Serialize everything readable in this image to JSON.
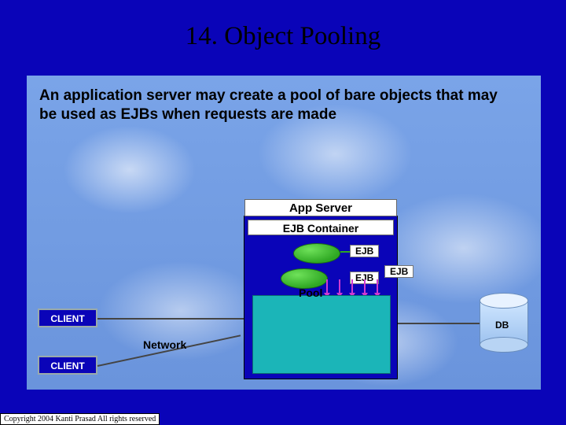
{
  "slide": {
    "title": "14. Object Pooling",
    "description": "An application server may create a pool of bare objects that may be used as EJBs when requests are made",
    "copyright": "Copyright 2004 Kanti Prasad All rights reserved"
  },
  "diagram": {
    "app_server_label": "App Server",
    "ejb_container_label": "EJB Container",
    "ejb_labels": [
      "EJB",
      "EJB",
      "EJB"
    ],
    "pool_label": "Pool",
    "clients": [
      "CLIENT",
      "CLIENT"
    ],
    "network_label": "Network",
    "db_label": "DB"
  }
}
